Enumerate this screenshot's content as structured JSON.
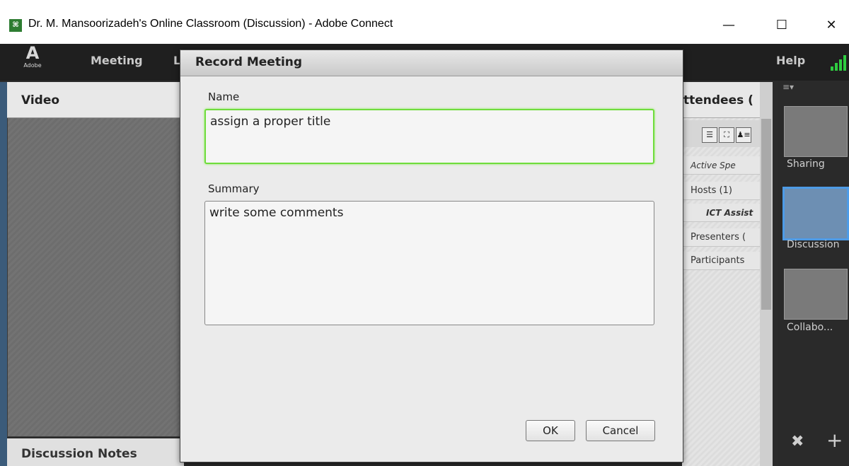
{
  "window": {
    "title": "Dr. M. Mansoorizadeh's Online Classroom (Discussion) - Adobe Connect",
    "icon_glyph": "⌘",
    "minimize": "—",
    "maximize": "☐",
    "close": "✕"
  },
  "menubar": {
    "logo_glyph": "A",
    "logo_text": "Adobe",
    "items": [
      "Meeting",
      "L"
    ],
    "help": "Help"
  },
  "video_pod": {
    "title": "Video"
  },
  "notes_pod": {
    "title": "Discussion Notes"
  },
  "attendees_pod": {
    "title": "ttendees (",
    "tools": [
      "☰",
      "⛶",
      "♟≡"
    ],
    "rows": [
      "Active Spe",
      "Hosts (1)",
      "ICT Assist",
      "Presenters (",
      "Participants"
    ]
  },
  "layouts": {
    "menu": "≡▾",
    "items": [
      {
        "label": "Sharing",
        "active": false
      },
      {
        "label": "Discussion",
        "active": true
      },
      {
        "label": "Collabo...",
        "active": false
      }
    ],
    "tools_icon": "✖",
    "add_icon": "+"
  },
  "dialog": {
    "title": "Record Meeting",
    "name_label": "Name",
    "name_value": "assign a proper title",
    "summary_label": "Summary",
    "summary_value": "write some comments",
    "ok_label": "OK",
    "cancel_label": "Cancel"
  },
  "colors": {
    "focus_ring": "#6fdc3c",
    "active_layout": "#4d9be6",
    "signal": "#2ecc40"
  }
}
